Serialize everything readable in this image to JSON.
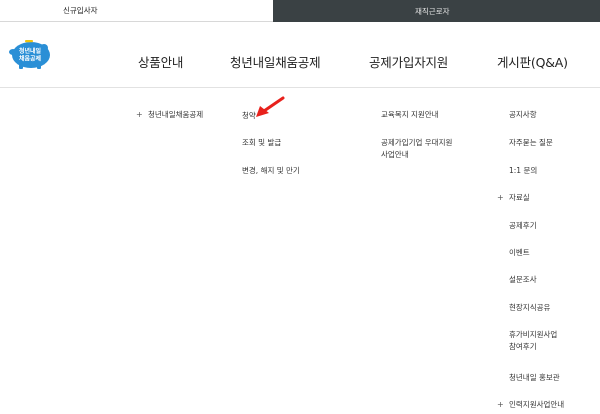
{
  "tabs": {
    "left": "신규입사자",
    "right": "재직근로자"
  },
  "logo": {
    "line1": "청년내일",
    "line2": "채움공제"
  },
  "nav": {
    "item1": "상품안내",
    "item2": "청년내일채움공제",
    "item3": "공제가입자지원",
    "item4": "게시판(Q&A)"
  },
  "col1": {
    "item1": "청년내일채움공제"
  },
  "col2": {
    "item1": "청약",
    "item2": "조회 및 발급",
    "item3": "변경, 해지 및 만기"
  },
  "col3": {
    "item1": "교육복지 지원안내",
    "item2_line1": "공제가입기업 우대지원",
    "item2_line2": "사업안내"
  },
  "col4": {
    "item1": "공지사항",
    "item2": "자주묻는 질문",
    "item3": "1:1 문의",
    "item4": "자료실",
    "item5": "공제후기",
    "item6": "이벤트",
    "item7": "설문조사",
    "item8": "현장지식공유",
    "item9_line1": "휴가비지원사업",
    "item9_line2": "참여후기",
    "item10": "청년내일 홍보관",
    "item11": "인력지원사업안내"
  },
  "icons": {
    "plus": "+"
  },
  "colors": {
    "dark_tab": "#3a4144",
    "arrow": "#e8211c",
    "logo_blue": "#2a8fd6"
  }
}
